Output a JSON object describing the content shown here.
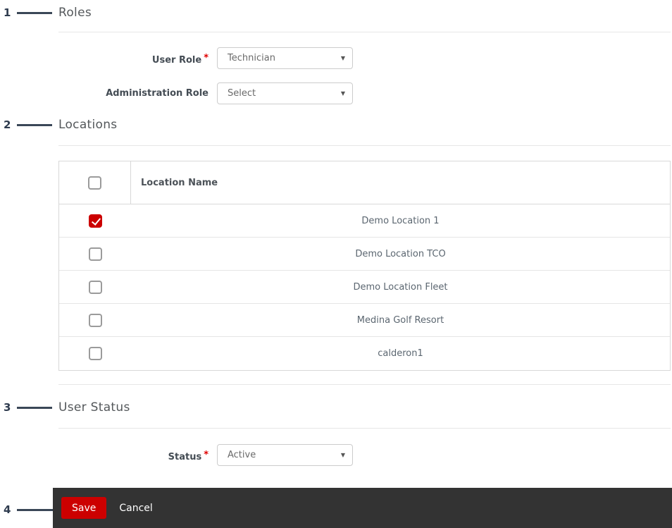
{
  "required_marker": "*",
  "annotations": [
    {
      "number": "1",
      "target": "roles-section"
    },
    {
      "number": "2",
      "target": "locations-section"
    },
    {
      "number": "3",
      "target": "user-status-section"
    },
    {
      "number": "4",
      "target": "save-button"
    }
  ],
  "sections": {
    "roles": {
      "title": "Roles",
      "fields": [
        {
          "label": "User Role",
          "required": true,
          "value": "Technician"
        },
        {
          "label": "Administration Role",
          "required": false,
          "value": "Select"
        }
      ]
    },
    "locations": {
      "title": "Locations",
      "table": {
        "header": "Location Name",
        "rows": [
          {
            "name": "Demo Location 1",
            "checked": true
          },
          {
            "name": "Demo Location TCO",
            "checked": false
          },
          {
            "name": "Demo Location Fleet",
            "checked": false
          },
          {
            "name": "Medina Golf Resort",
            "checked": false
          },
          {
            "name": "calderon1",
            "checked": false
          }
        ]
      }
    },
    "user_status": {
      "title": "User Status",
      "fields": [
        {
          "label": "Status",
          "required": true,
          "value": "Active"
        }
      ]
    }
  },
  "footer": {
    "save_label": "Save",
    "cancel_label": "Cancel"
  },
  "colors": {
    "accent_red": "#cc0000",
    "footer_bg": "#333333",
    "annotation_navy": "#2e3b4e",
    "divider_gray": "#e7e7e7"
  }
}
